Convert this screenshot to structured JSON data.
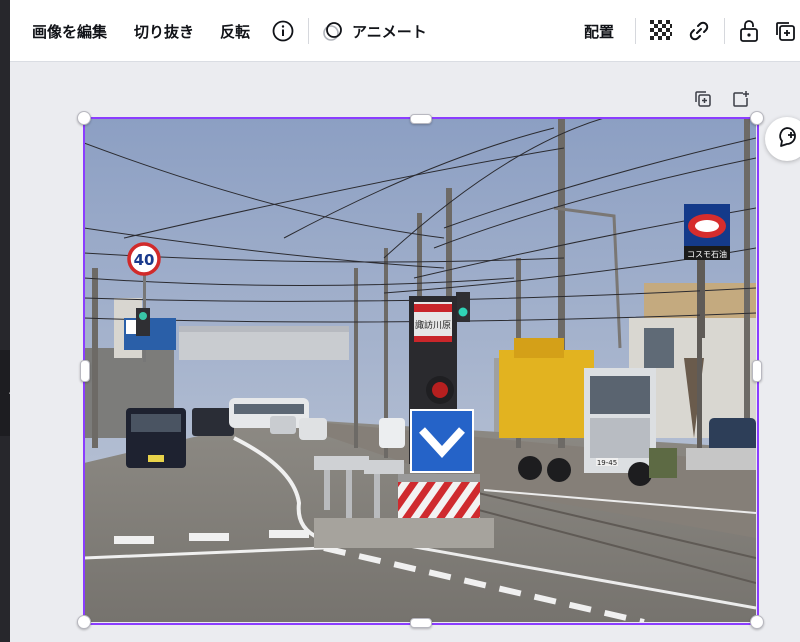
{
  "toolbar": {
    "edit_image": "画像を編集",
    "crop": "切り抜き",
    "flip": "反転",
    "info_icon": "info-icon",
    "animate": "アニメート",
    "position": "配置",
    "transparency_icon": "checkerboard-transparency-icon",
    "link_icon": "link-icon",
    "lock_icon": "lock-icon",
    "duplicate_icon": "duplicate-page-icon"
  },
  "canvas": {
    "duplicate_icon": "duplicate-icon",
    "add_page_icon": "add-page-icon",
    "comment_icon": "add-comment-icon"
  },
  "photo": {
    "speed_sign": "40",
    "store_sign": "コスモ石油",
    "stop_name": "諏訪川原",
    "truck_plate": "19-45"
  },
  "colors": {
    "selection": "#8b3dff",
    "toolbar_bg": "#ffffff",
    "canvas_bg": "#ebecf0",
    "rail": "#27272c"
  }
}
